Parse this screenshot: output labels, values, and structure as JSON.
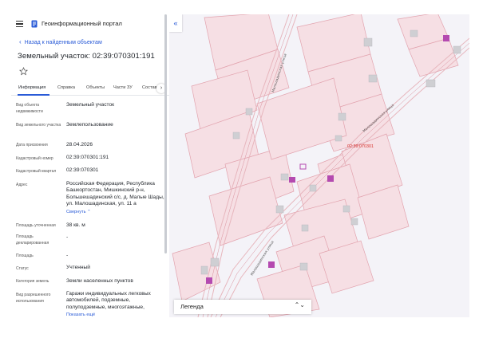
{
  "header": {
    "app_title": "Геоинформационный портал",
    "menu_icon": "hamburger-icon",
    "logo_icon": "document-logo-icon"
  },
  "back_link": "Назад к найденным объектам",
  "page_title": "Земельный участок: 02:39:070301:191",
  "tabs": [
    {
      "label": "Информация",
      "active": true
    },
    {
      "label": "Справка"
    },
    {
      "label": "Объекты"
    },
    {
      "label": "Части ЗУ"
    },
    {
      "label": "Состав"
    }
  ],
  "properties": [
    {
      "label": "Вид объекта недвижимости",
      "value": "Земельный участок"
    },
    {
      "label": "Вид земельного участка",
      "value": "Землепользование"
    },
    {
      "label": "Дата присвоения",
      "value": "28.04.2026"
    },
    {
      "label": "Кадастровый номер",
      "value": "02:39:070301:191"
    },
    {
      "label": "Кадастровый квартал",
      "value": "02:39:070301"
    },
    {
      "label": "Адрес",
      "value": "Российская Федерация, Республика Башкортостан, Мишкинский р-н, Большешадинский с/с, д. Малые Шады, ул. Малошадинская, ул. 11 а",
      "link": "Свернуть ⌃"
    },
    {
      "label": "Площадь уточненная",
      "value": "38 кв. м"
    },
    {
      "label": "Площадь декларированная",
      "value": "-"
    },
    {
      "label": "Площадь",
      "value": "-"
    },
    {
      "label": "Статус",
      "value": "Учтенный"
    },
    {
      "label": "Категория земель",
      "value": "Земли населенных пунктов"
    },
    {
      "label": "Вид разрешенного использования",
      "value": "Гаражи индивидуальных легковых автомобилей, подземные, полуподземные, многоэтажные,",
      "link": "Показать ещё"
    }
  ],
  "map": {
    "collapse_label": "«",
    "parcel_label": "02:39:070301",
    "street_labels": [
      "Малошадинская улица",
      "Малошадинская улица",
      "Малошадинская улица"
    ],
    "legend_label": "Легенда",
    "legend_arrows": "⌃⌄",
    "colors": {
      "parcel_fill": "#f6dfe4",
      "parcel_stroke": "#e2a3ae",
      "building": "#cfcfd3",
      "selected": "#b44ab0",
      "road": "#e7b6bd",
      "background": "#f4f3f8"
    }
  }
}
